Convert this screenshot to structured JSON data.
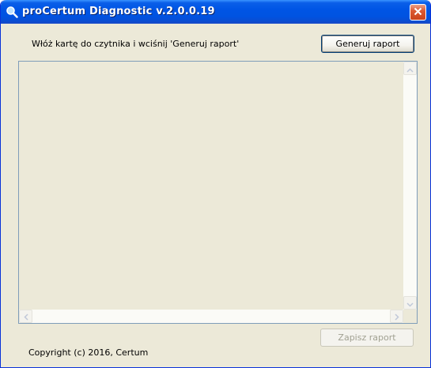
{
  "window": {
    "title": "proCertum Diagnostic v.2.0.0.19",
    "app_icon": "magnifier-icon",
    "close_icon": "close-icon"
  },
  "main": {
    "instruction_text": "Włóż kartę do czytnika i wciśnij 'Generuj raport'",
    "generate_button_label": "Generuj raport",
    "report_text": "",
    "save_button_label": "Zapisz raport",
    "save_button_enabled": false
  },
  "footer": {
    "copyright": "Copyright (c) 2016, Certum"
  },
  "colors": {
    "titlebar": "#0055e5",
    "window_bg": "#ece9d8",
    "close_button": "#dc5a33",
    "disabled_text": "#a1a192"
  }
}
